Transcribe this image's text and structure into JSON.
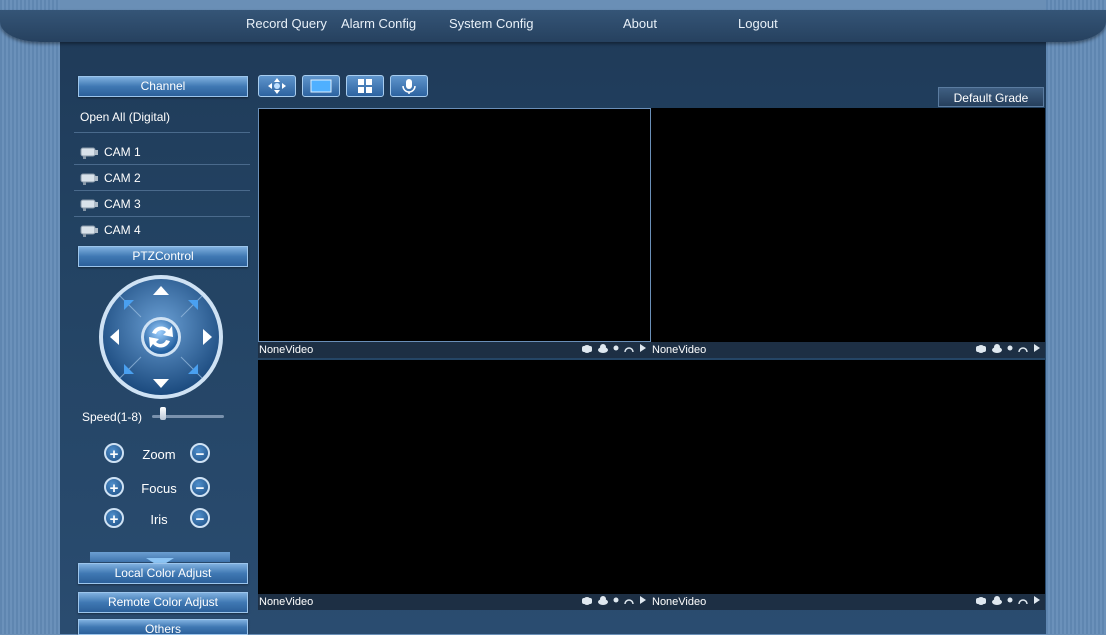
{
  "nav": [
    "Record Query",
    "Alarm Config",
    "System Config",
    "About",
    "Logout"
  ],
  "sidebar": {
    "channel_header": "Channel",
    "open_all": "Open All (Digital)",
    "cams": [
      "CAM 1",
      "CAM 2",
      "CAM 3",
      "CAM 4"
    ],
    "ptz_header": "PTZControl",
    "speed_label": "Speed(1-8)",
    "zoom": "Zoom",
    "focus": "Focus",
    "iris": "Iris",
    "local_color": "Local Color Adjust",
    "remote_color": "Remote Color Adjust",
    "others": "Others"
  },
  "toolbar": {
    "icons": [
      "ptz-move-icon",
      "single-view-icon",
      "quad-view-icon",
      "microphone-icon"
    ],
    "grade": "Default Grade"
  },
  "videos": [
    {
      "label": "NoneVideo"
    },
    {
      "label": "NoneVideo"
    },
    {
      "label": "NoneVideo"
    },
    {
      "label": "NoneVideo"
    }
  ],
  "colors": {
    "accent": "#3f78b3",
    "video_bg": "#000000",
    "frame": "#234363"
  }
}
